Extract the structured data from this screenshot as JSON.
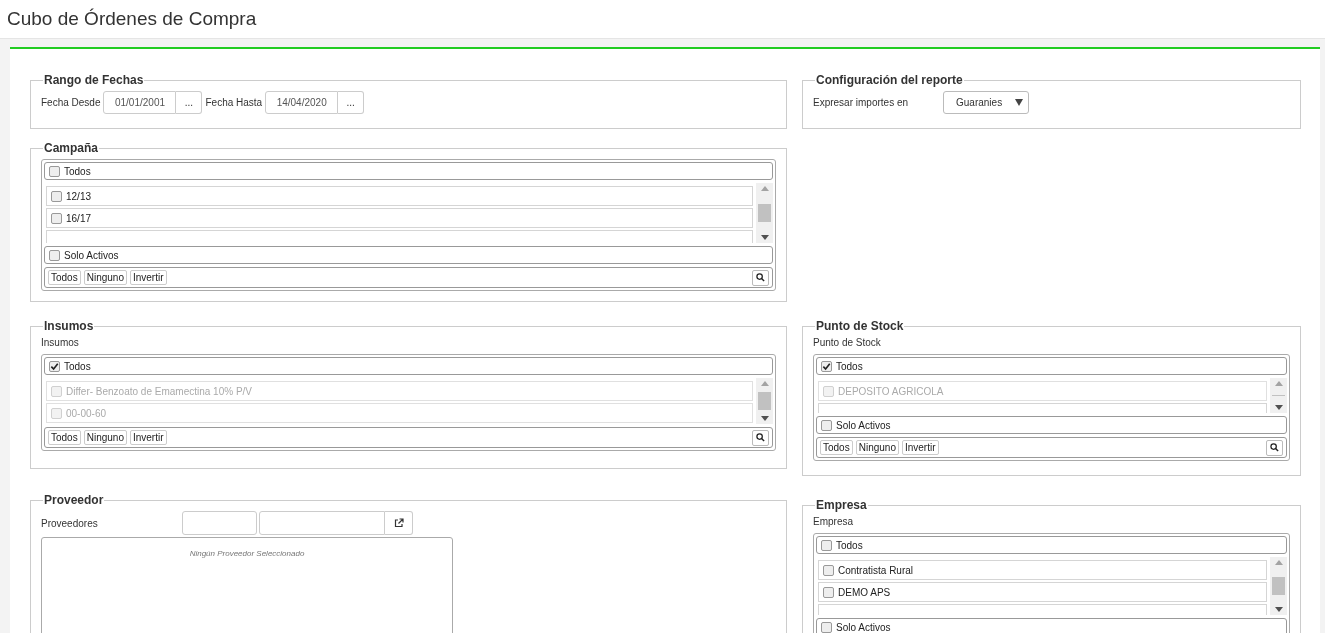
{
  "page": {
    "title": "Cubo de Órdenes de Compra"
  },
  "rango_fechas": {
    "legend": "Rango de Fechas",
    "fields": [
      {
        "label": "Fecha Desde",
        "value": "01/01/2001",
        "button": "..."
      },
      {
        "label": "Fecha Hasta",
        "value": "14/04/2020",
        "button": "..."
      }
    ]
  },
  "configuracion": {
    "legend": "Configuración del reporte",
    "label": "Expresar importes en",
    "value": "Guaranies"
  },
  "campana": {
    "legend": "Campaña",
    "todos": {
      "label": "Todos",
      "checked": false
    },
    "items": [
      {
        "label": "12/13",
        "checked": false,
        "disabled": false
      },
      {
        "label": "16/17",
        "checked": false,
        "disabled": false
      }
    ],
    "solo_activos": {
      "label": "Solo Activos",
      "checked": false
    },
    "buttons": [
      "Todos",
      "Ninguno",
      "Invertir"
    ]
  },
  "insumos": {
    "legend": "Insumos",
    "label": "Insumos",
    "todos": {
      "label": "Todos",
      "checked": true
    },
    "items": [
      {
        "label": "Differ- Benzoato de Emamectina 10% P/V",
        "checked": false,
        "disabled": true
      },
      {
        "label": "00-00-60",
        "checked": false,
        "disabled": true
      }
    ],
    "buttons": [
      "Todos",
      "Ninguno",
      "Invertir"
    ]
  },
  "punto_stock": {
    "legend": "Punto de Stock",
    "label": "Punto de Stock",
    "todos": {
      "label": "Todos",
      "checked": true
    },
    "items": [
      {
        "label": "DEPOSITO AGRICOLA",
        "checked": false,
        "disabled": true
      }
    ],
    "solo_activos": {
      "label": "Solo Activos",
      "checked": false
    },
    "buttons": [
      "Todos",
      "Ninguno",
      "Invertir"
    ]
  },
  "proveedor": {
    "legend": "Proveedor",
    "label": "Proveedores",
    "empty_text": "Ningún Proveedor Seleccionado"
  },
  "empresa": {
    "legend": "Empresa",
    "label": "Empresa",
    "todos": {
      "label": "Todos",
      "checked": false
    },
    "items": [
      {
        "label": "Contratista Rural",
        "checked": false,
        "disabled": false
      },
      {
        "label": "DEMO APS",
        "checked": false,
        "disabled": false
      }
    ],
    "solo_activos": {
      "label": "Solo Activos",
      "checked": false
    }
  }
}
